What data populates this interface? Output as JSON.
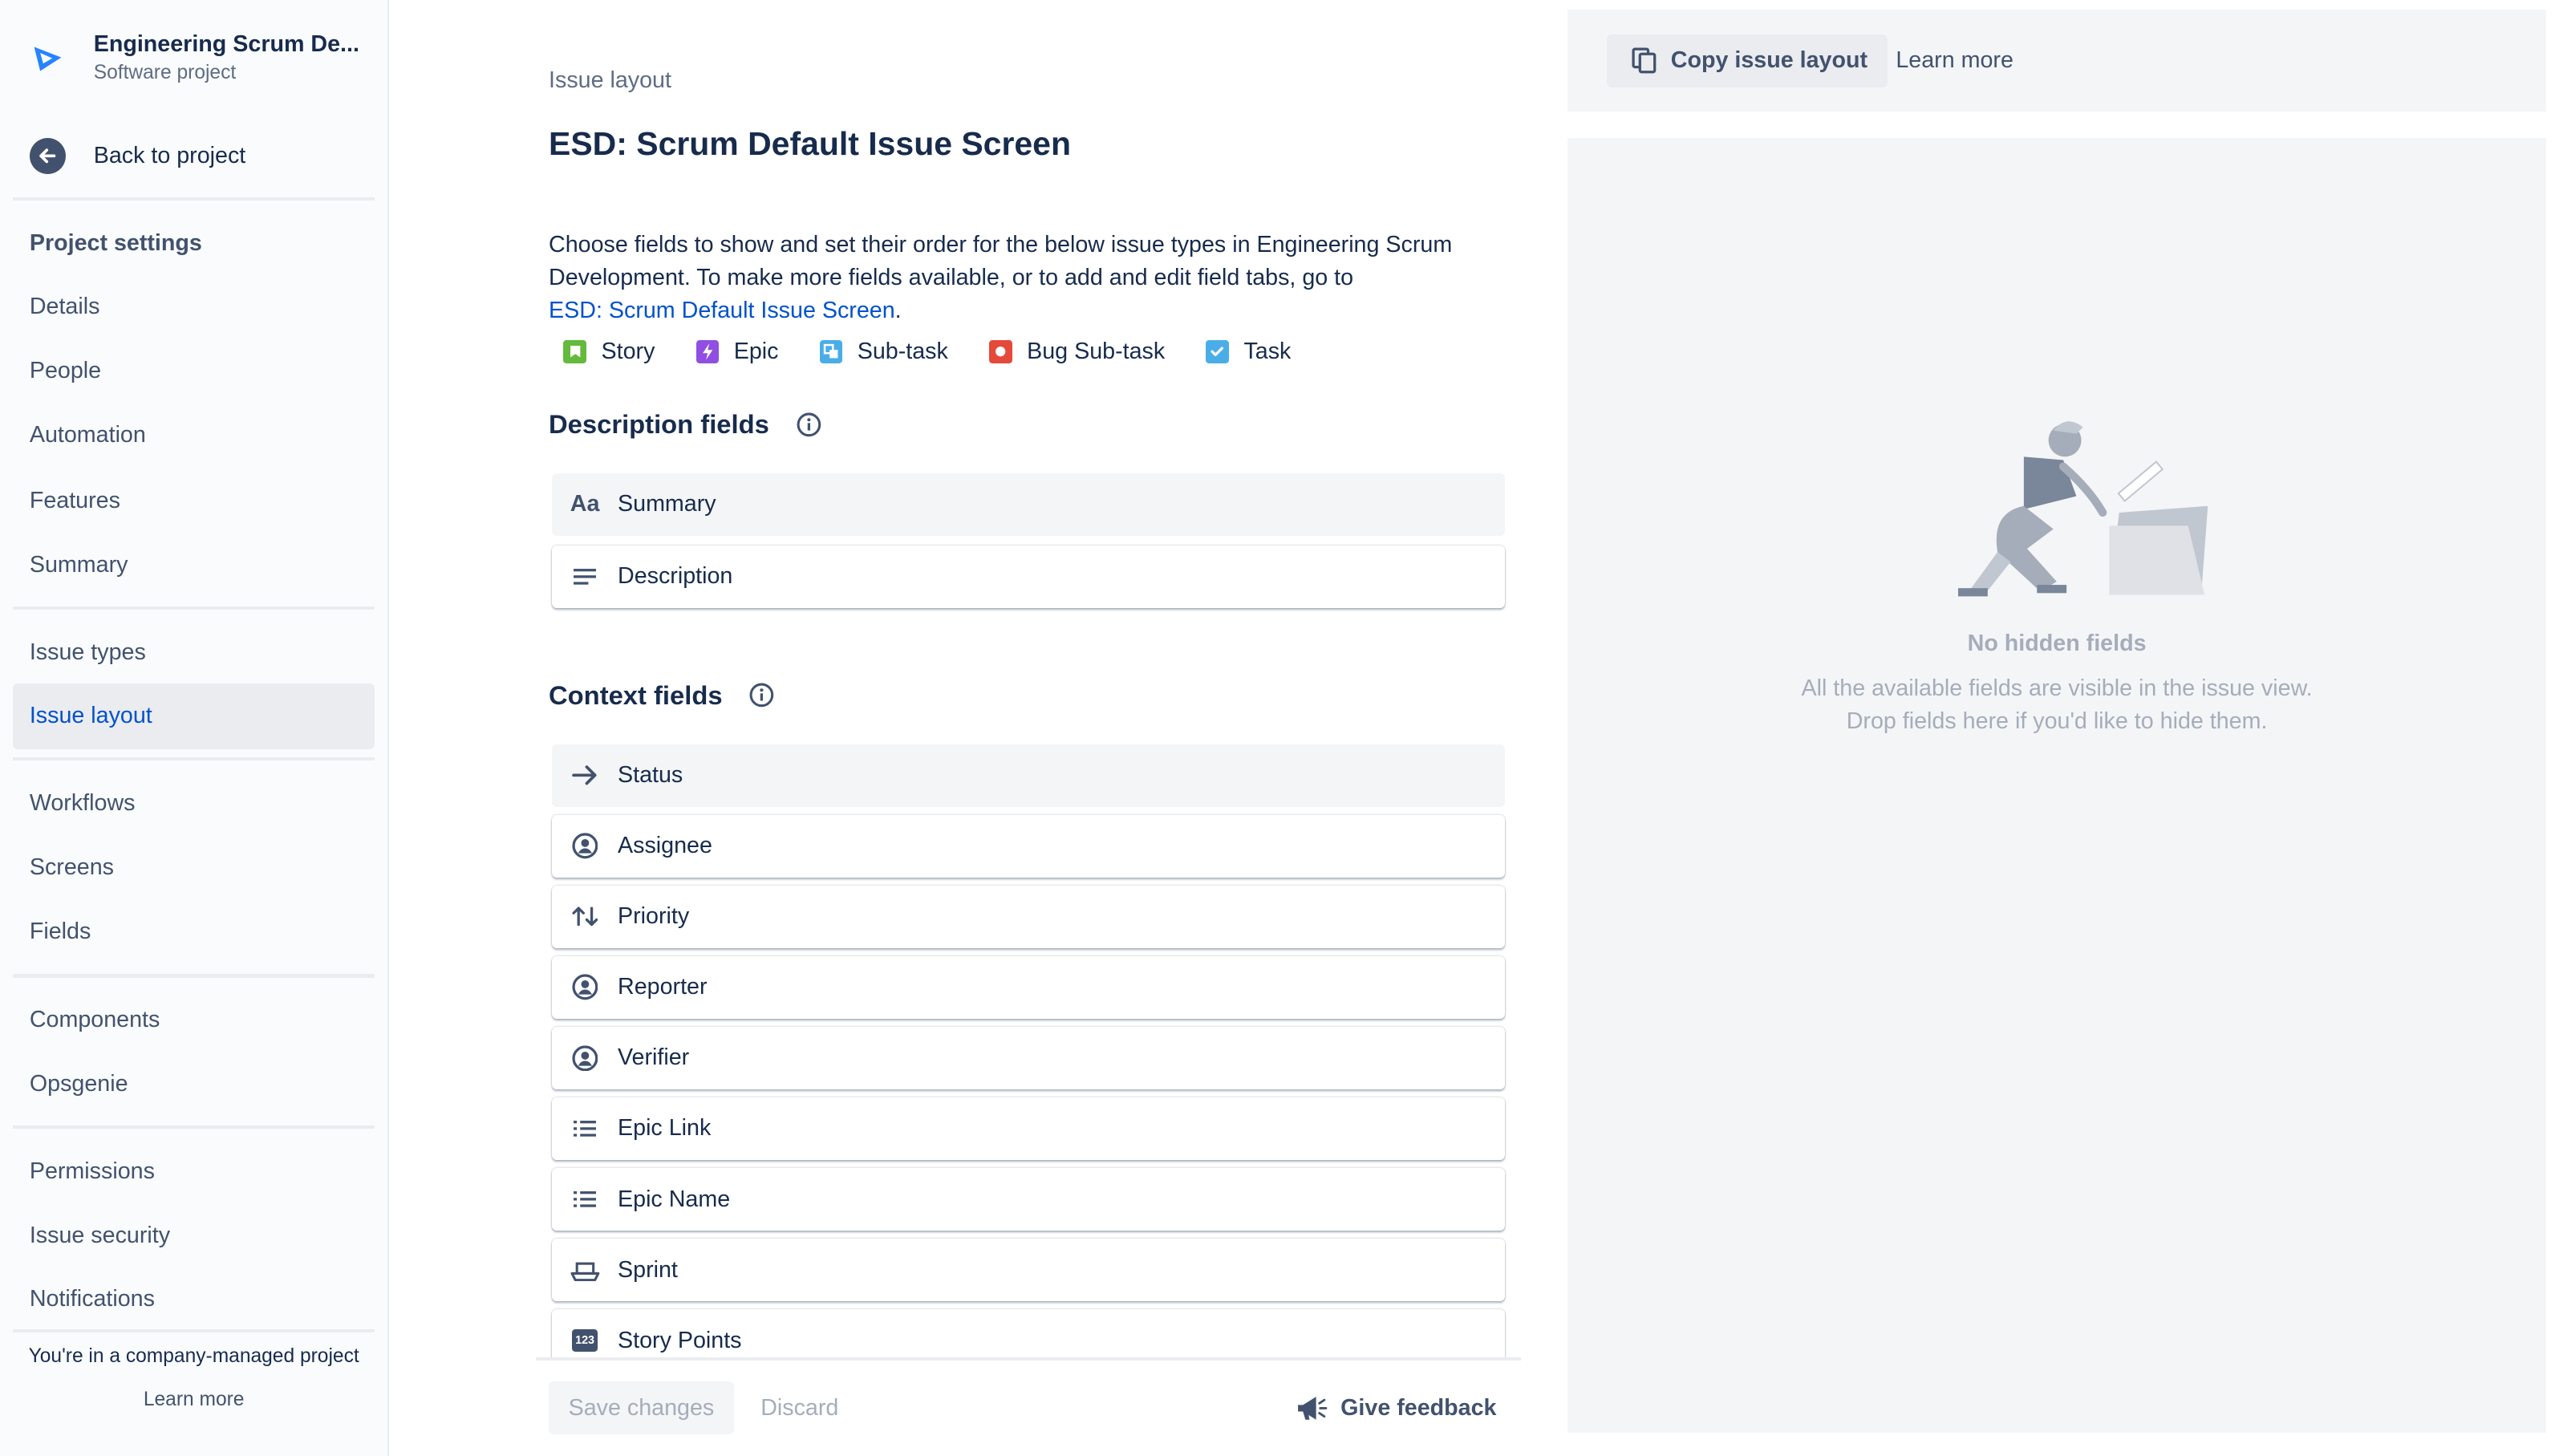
{
  "sidebar": {
    "project_name": "Engineering Scrum De...",
    "project_type": "Software project",
    "back_label": "Back to project",
    "section_title": "Project settings",
    "group1": [
      "Details",
      "People",
      "Automation",
      "Features",
      "Summary"
    ],
    "group2": [
      "Issue types",
      "Issue layout"
    ],
    "group3": [
      "Workflows",
      "Screens",
      "Fields"
    ],
    "group4": [
      "Components",
      "Opsgenie"
    ],
    "group5": [
      "Permissions",
      "Issue security",
      "Notifications"
    ],
    "active_item": "Issue layout",
    "managed_note": "You're in a company-managed project",
    "managed_learn": "Learn more"
  },
  "main": {
    "breadcrumb": "Issue layout",
    "title": "ESD: Scrum Default Issue Screen",
    "description_text": "Choose fields to show and set their order for the below issue types in Engineering Scrum Development. To make more fields available, or to add and edit field tabs, go to",
    "description_link": "ESD: Scrum Default Issue Screen",
    "description_end": ".",
    "issue_types": [
      {
        "label": "Story",
        "color": "#63BA3C",
        "icon": "story-icon"
      },
      {
        "label": "Epic",
        "color": "#904EE2",
        "icon": "epic-icon"
      },
      {
        "label": "Sub-task",
        "color": "#4BADE8",
        "icon": "subtask-icon"
      },
      {
        "label": "Bug Sub-task",
        "color": "#E5493A",
        "icon": "bug-icon"
      },
      {
        "label": "Task",
        "color": "#4BADE8",
        "icon": "task-icon"
      }
    ],
    "description_fields_title": "Description fields",
    "description_fields": [
      {
        "label": "Summary",
        "icon": "text-icon",
        "glyph": "Aa"
      },
      {
        "label": "Description",
        "icon": "paragraph-icon"
      }
    ],
    "context_fields_title": "Context fields",
    "context_fields": [
      {
        "label": "Status",
        "icon": "arrow-right-icon"
      },
      {
        "label": "Assignee",
        "icon": "person-icon"
      },
      {
        "label": "Priority",
        "icon": "priority-arrows-icon"
      },
      {
        "label": "Reporter",
        "icon": "person-icon"
      },
      {
        "label": "Verifier",
        "icon": "person-icon"
      },
      {
        "label": "Epic Link",
        "icon": "list-icon"
      },
      {
        "label": "Epic Name",
        "icon": "list-icon"
      },
      {
        "label": "Sprint",
        "icon": "sprint-icon"
      },
      {
        "label": "Story Points",
        "icon": "number-icon",
        "glyph": "123"
      }
    ],
    "save_label": "Save changes",
    "discard_label": "Discard",
    "feedback_label": "Give feedback"
  },
  "right_panel": {
    "copy_label": "Copy issue layout",
    "learn_label": "Learn more",
    "empty_title": "No hidden fields",
    "empty_line1": "All the available fields are visible in the issue view.",
    "empty_line2": "Drop fields here if you'd like to hide them."
  },
  "colors": {
    "link": "#0052CC",
    "text": "#172B4D",
    "subtle": "#42526E",
    "panel_bg": "#F4F5F7"
  }
}
